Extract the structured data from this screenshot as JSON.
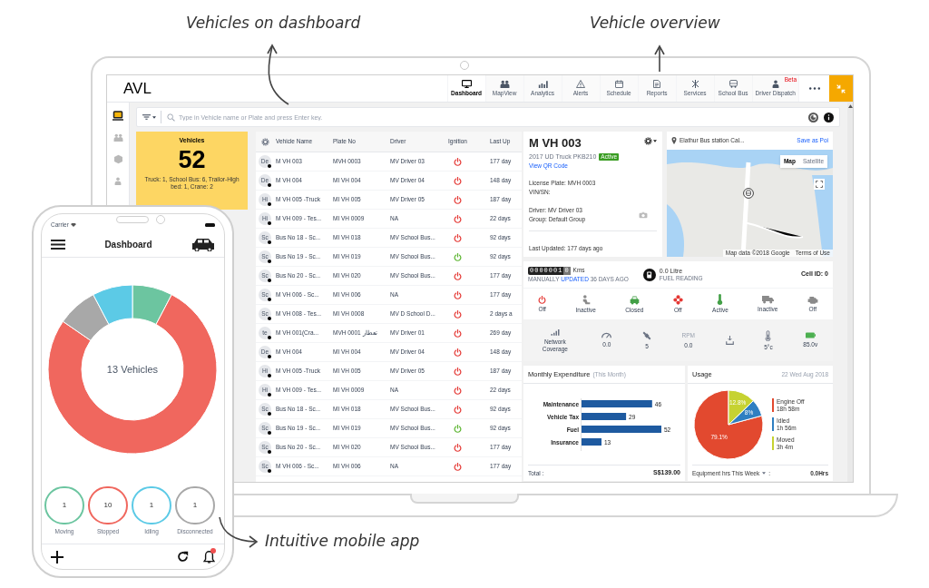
{
  "annotations": [
    "Vehicles on dashboard",
    "Vehicle overview",
    "Intuitive mobile app"
  ],
  "app": {
    "title": "AVL",
    "nav": [
      {
        "label": "Dashboard",
        "selected": true
      },
      {
        "label": "MapView",
        "selected": false
      },
      {
        "label": "Analytics",
        "selected": false
      },
      {
        "label": "Alerts",
        "selected": false
      },
      {
        "label": "Schedule",
        "selected": false
      },
      {
        "label": "Reports",
        "selected": false
      },
      {
        "label": "Services",
        "selected": false
      },
      {
        "label": "School Bus",
        "selected": false
      },
      {
        "label": "Driver Dispatch",
        "selected": false,
        "tag": "Beta"
      }
    ],
    "rail": [
      {
        "selected": true
      },
      {
        "selected": false
      },
      {
        "selected": false
      },
      {
        "selected": false
      }
    ],
    "search": {
      "placeholder": "Type in Vehicle name or Plate and press Enter key."
    },
    "vehicles_card": {
      "title": "Vehicles",
      "count": "52",
      "breakdown": "Truck: 1, School Bus: 6, Trailor-High bed: 1, Crane: 2"
    },
    "table": {
      "columns": [
        "Vehicle Name",
        "Plate No",
        "Driver",
        "Ignition",
        "Last Up"
      ],
      "rows": [
        {
          "avatar": "De",
          "vehicle": "M VH 003",
          "plate": "MVH 0003",
          "driver": "MV Driver 03",
          "ignition_on": false,
          "last_update": "177 day"
        },
        {
          "avatar": "De",
          "vehicle": "M VH 004",
          "plate": "MI VH 004",
          "driver": "MV Driver 04",
          "ignition_on": false,
          "last_update": "148 day"
        },
        {
          "avatar": "Hi",
          "vehicle": "M VH 005 -Truck",
          "plate": "MI VH 005",
          "driver": "MV Driver 05",
          "ignition_on": false,
          "last_update": "187 day"
        },
        {
          "avatar": "Hi",
          "vehicle": "M VH 009 - Tes...",
          "plate": "MI VH 0009",
          "driver": "NA",
          "ignition_on": false,
          "last_update": "22 days"
        },
        {
          "avatar": "Sc",
          "vehicle": "Bus No 18 - Sc...",
          "plate": "MI VH 018",
          "driver": "MV School Bus...",
          "ignition_on": false,
          "last_update": "92 days"
        },
        {
          "avatar": "Sc",
          "vehicle": "Bus No 19 - Sc...",
          "plate": "MI VH 019",
          "driver": "MV School Bus...",
          "ignition_on": true,
          "last_update": "92 days"
        },
        {
          "avatar": "Sc",
          "vehicle": "Bus No 20 - Sc...",
          "plate": "MI VH 020",
          "driver": "MV School Bus...",
          "ignition_on": false,
          "last_update": "177 day"
        },
        {
          "avatar": "Sc",
          "vehicle": "M VH 006 - Sc...",
          "plate": "MI VH 006",
          "driver": "NA",
          "ignition_on": false,
          "last_update": "177 day"
        },
        {
          "avatar": "Sc",
          "vehicle": "M VH 008 - Tes...",
          "plate": "MI VH 0008",
          "driver": "MV D School D...",
          "ignition_on": false,
          "last_update": "2 days a"
        },
        {
          "avatar": "te",
          "vehicle": "M VH 001(Cra...",
          "plate": "MVH 0001 تعطار",
          "driver": "MV Driver 01",
          "ignition_on": false,
          "last_update": "269 day"
        },
        {
          "avatar": "De",
          "vehicle": "M VH 004",
          "plate": "MI VH 004",
          "driver": "MV Driver 04",
          "ignition_on": false,
          "last_update": "148 day"
        },
        {
          "avatar": "Hi",
          "vehicle": "M VH 005 -Truck",
          "plate": "MI VH 005",
          "driver": "MV Driver 05",
          "ignition_on": false,
          "last_update": "187 day"
        },
        {
          "avatar": "Hi",
          "vehicle": "M VH 009 - Tes...",
          "plate": "MI VH 0009",
          "driver": "NA",
          "ignition_on": false,
          "last_update": "22 days"
        },
        {
          "avatar": "Sc",
          "vehicle": "Bus No 18 - Sc...",
          "plate": "MI VH 018",
          "driver": "MV School Bus...",
          "ignition_on": false,
          "last_update": "92 days"
        },
        {
          "avatar": "Sc",
          "vehicle": "Bus No 19 - Sc...",
          "plate": "MI VH 019",
          "driver": "MV School Bus...",
          "ignition_on": true,
          "last_update": "92 days"
        },
        {
          "avatar": "Sc",
          "vehicle": "Bus No 20 - Sc...",
          "plate": "MI VH 020",
          "driver": "MV School Bus...",
          "ignition_on": false,
          "last_update": "177 day"
        },
        {
          "avatar": "Sc",
          "vehicle": "M VH 006 - Sc...",
          "plate": "MI VH 006",
          "driver": "NA",
          "ignition_on": false,
          "last_update": "177 day"
        }
      ]
    },
    "vehicle": {
      "name": "M VH 003",
      "model": "2017 UD Truck PKB210",
      "status": "Active",
      "qr_link": "View QR Code",
      "info_groups": [
        [
          "License Plate: MVH 0003",
          "VIN/SN:"
        ],
        [
          "Driver: MV Driver 03",
          "Group: Default Group"
        ]
      ],
      "last_updated": "Last Updated: 177 days ago"
    },
    "map": {
      "location": "Elathur Bus station Cal...",
      "action": "Save as Poi",
      "map_types": [
        {
          "label": "Map",
          "selected": true
        },
        {
          "label": "Satellite",
          "selected": false
        }
      ],
      "attribution": "Map data ©2018 Google",
      "terms": "Terms of Use"
    },
    "telemetry": {
      "odometer": {
        "digits": "0000001",
        "last_digit": "0",
        "unit": "Kms",
        "note_before": "MANUALLY",
        "note_link": "UPDATED",
        "note_after": "36 DAYS AGO"
      },
      "fuel": {
        "value": "0.0 Litre",
        "caption": "FUEL READING"
      },
      "cell_id": "Cell ID: 0",
      "statuses": [
        {
          "label": "Off",
          "color": "#e53935"
        },
        {
          "label": "Inactive",
          "color": "#8a8a8a"
        },
        {
          "label": "Closed",
          "color": "#43a047"
        },
        {
          "label": "Off",
          "color": "#e53935"
        },
        {
          "label": "Active",
          "color": "#43a047"
        },
        {
          "label": "Inactive",
          "color": "#8a8a8a"
        },
        {
          "label": "Off",
          "color": "#8a8a8a"
        }
      ]
    },
    "sensors": [
      {
        "kind": "signal",
        "text": "Network Coverage"
      },
      {
        "kind": "gauge",
        "text": "0.0"
      },
      {
        "kind": "satellite",
        "text": "5"
      },
      {
        "kind": "rpm",
        "caption": "RPM",
        "text": "0.0"
      },
      {
        "kind": "level"
      },
      {
        "kind": "temperature",
        "text": "5°c"
      },
      {
        "kind": "battery",
        "text": "85.0v"
      }
    ],
    "expenditure": {
      "title": "Monthly Expenditure",
      "subtitle": "(This Month)",
      "chart_data": {
        "type": "bar",
        "orientation": "horizontal",
        "categories": [
          "Maintenance",
          "Vehicle Tax",
          "Fuel",
          "Insurance"
        ],
        "values": [
          46,
          29,
          52,
          13
        ],
        "data_labels": true
      },
      "total_label": "Total :",
      "total": "S$139.00"
    },
    "usage": {
      "title": "Usage",
      "date": "22 Wed Aug 2018",
      "chart_data": {
        "type": "pie",
        "categories": [
          "Engine Off",
          "Idled",
          "Moved"
        ],
        "values": [
          79.1,
          8,
          12.8
        ],
        "value_labels": [
          "79.1%",
          "8%",
          "12.8%"
        ],
        "colors": [
          "#e2492f",
          "#2f7fc1",
          "#c6d231"
        ]
      },
      "durations": [
        "18h 58m",
        "1h 56m",
        "3h 4m"
      ],
      "footer_label": "Equipment hrs This Week",
      "footer_separator": ":",
      "footer_value": "0.0Hrs"
    }
  },
  "phone": {
    "carrier": "Carrier",
    "title": "Dashboard",
    "chart": {
      "center_text": "13 Vehicles",
      "chart_data": {
        "type": "donut",
        "values": [
          7.7,
          76.9,
          7.7,
          7.7
        ],
        "colors": [
          "#6cc5a0",
          "#f0675e",
          "#a8a8a8",
          "#5ccae6"
        ]
      }
    },
    "statuses": [
      {
        "count": "1",
        "label": "Moving",
        "color": "#6cc5a0"
      },
      {
        "count": "10",
        "label": "Stopped",
        "color": "#f0675e"
      },
      {
        "count": "1",
        "label": "Idling",
        "color": "#5ccae6"
      },
      {
        "count": "1",
        "label": "Disconnected",
        "color": "#a8a8a8"
      }
    ]
  }
}
